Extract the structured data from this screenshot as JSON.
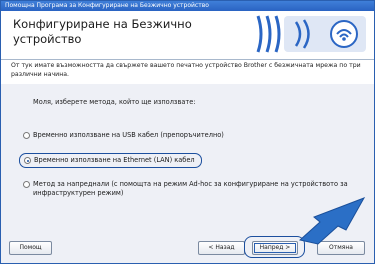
{
  "window": {
    "title": "Помощна Програма за Конфигуриране на Безжично устройство"
  },
  "header": {
    "title": "Конфигуриране на Безжично устройство"
  },
  "intro": {
    "text": "От тук имате възможността да свържете вашето печатно устройство Brother с безжичната мрежа по три различни начина."
  },
  "body": {
    "prompt": "Моля, изберете метода, който ще използвате:",
    "options": [
      {
        "label": "Временно използване на USB кабел (препоръчително)",
        "selected": false
      },
      {
        "label": "Временно използване на Ethernet (LAN) кабел",
        "selected": true
      },
      {
        "label": "Метод за напреднали (с помощта на режим Ad-hoc за конфигуриране на устройството за инфраструктурен режим)",
        "selected": false
      }
    ]
  },
  "buttons": {
    "help": "Помощ",
    "back": "< Назад",
    "next": "Напред >",
    "cancel": "Отмяна"
  },
  "colors": {
    "titlebar": "#2a63c2",
    "accent": "#1c4f9e",
    "panel": "#eef0f6"
  },
  "icons": {
    "logo": "wireless-signal-logo",
    "pointer": "blue-arrow-pointer"
  }
}
